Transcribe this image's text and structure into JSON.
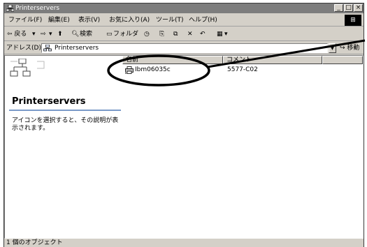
{
  "window": {
    "title": "Printerservers",
    "minimize_glyph": "_",
    "maximize_glyph": "□",
    "close_glyph": "×"
  },
  "menu": {
    "items": [
      "ファイル(F)",
      "編集(E)",
      "表示(V)",
      "お気に入り(A)",
      "ツール(T)",
      "ヘルプ(H)"
    ]
  },
  "toolbar": {
    "back_label": "⇦ 戻る",
    "back_dropdown": "▾",
    "forward_label": "⇨",
    "forward_dropdown": "▾",
    "up_glyph": "⬆",
    "search_label": "検索",
    "folders_label": "フォルダ",
    "history_glyph": "◷",
    "move_glyph": "⎘",
    "copy_glyph": "⧉",
    "delete_glyph": "✕",
    "undo_glyph": "↶",
    "views_glyph": "▦",
    "views_dropdown": "▾"
  },
  "address": {
    "label": "アドレス(D)",
    "value": "Printerservers",
    "go_label": "移動"
  },
  "left_pane": {
    "folder_title": "Printerservers",
    "info_text": "アイコンを選択すると、その説明が表示されます。"
  },
  "list": {
    "columns": [
      "名前",
      "コメント"
    ],
    "rows": [
      {
        "name": "Ibm06035c",
        "comment": "5577-C02"
      }
    ]
  },
  "status": {
    "text": "1 個のオブジェクト"
  },
  "colors": {
    "titlebar": "#7d7d7d",
    "face": "#d4d0c8",
    "callout": "#000000"
  },
  "icons": {
    "title": "network-icon",
    "address": "network-icon",
    "row": "printer-icon"
  }
}
